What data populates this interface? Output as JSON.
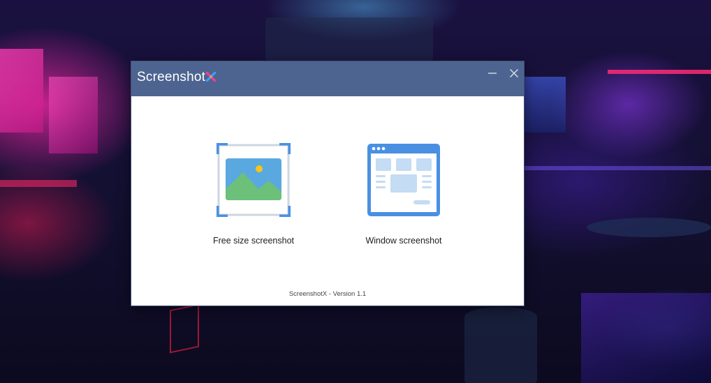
{
  "window": {
    "title": "Screenshot",
    "logo_icon": "x-logo-icon",
    "controls": {
      "minimize_icon": "minimize-icon",
      "close_icon": "close-icon"
    }
  },
  "options": [
    {
      "label": "Free size screenshot",
      "icon": "image-crop-icon"
    },
    {
      "label": "Window screenshot",
      "icon": "window-layout-icon"
    }
  ],
  "footer": {
    "version_text": "ScreenshotX - Version 1.1"
  },
  "colors": {
    "titlebar": "#4e6490",
    "accent_blue": "#4a90e2",
    "window_icon_fill": "#cfe3f7",
    "image_sky": "#5aa8e0",
    "image_mountain": "#6cc07a",
    "image_sun": "#f5c518",
    "logo_pink": "#ff3c8e",
    "logo_blue": "#3aa0ff"
  }
}
